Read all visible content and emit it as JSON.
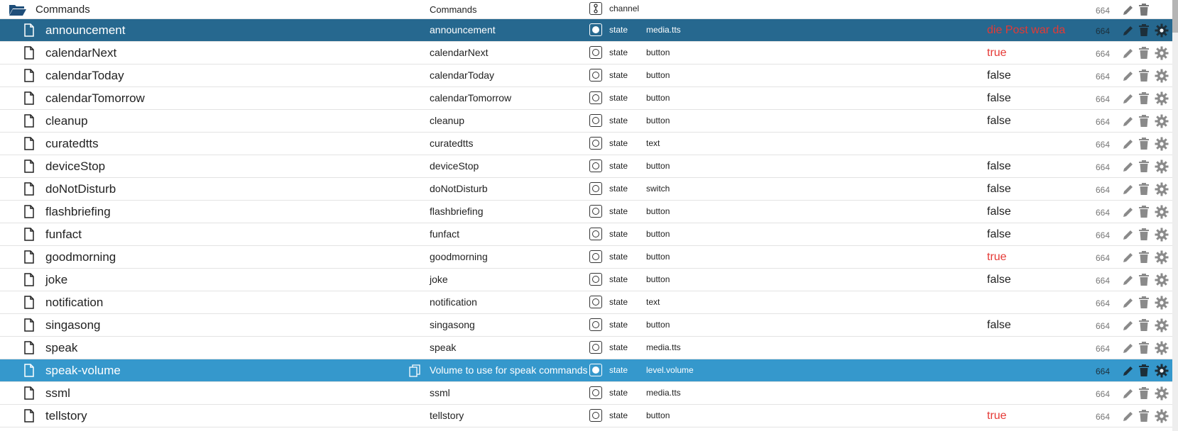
{
  "colors": {
    "selected_dark": "#26688f",
    "selected_light": "#3598cc",
    "value_true": "#e53935",
    "value_false": "#222222"
  },
  "folder": {
    "id": "Commands",
    "name": "Commands",
    "type": "channel",
    "acl": "664",
    "icon": "folder-open-icon"
  },
  "rows": [
    {
      "id": "announcement",
      "name": "announcement",
      "type": "state",
      "role": "media.tts",
      "value": "die Post war da",
      "value_color": "red",
      "acl": "664",
      "selected": "dark"
    },
    {
      "id": "calendarNext",
      "name": "calendarNext",
      "type": "state",
      "role": "button",
      "value": "true",
      "value_color": "red",
      "acl": "664"
    },
    {
      "id": "calendarToday",
      "name": "calendarToday",
      "type": "state",
      "role": "button",
      "value": "false",
      "value_color": "dark",
      "acl": "664"
    },
    {
      "id": "calendarTomorrow",
      "name": "calendarTomorrow",
      "type": "state",
      "role": "button",
      "value": "false",
      "value_color": "dark",
      "acl": "664"
    },
    {
      "id": "cleanup",
      "name": "cleanup",
      "type": "state",
      "role": "button",
      "value": "false",
      "value_color": "dark",
      "acl": "664"
    },
    {
      "id": "curatedtts",
      "name": "curatedtts",
      "type": "state",
      "role": "text",
      "value": "",
      "value_color": "dark",
      "acl": "664"
    },
    {
      "id": "deviceStop",
      "name": "deviceStop",
      "type": "state",
      "role": "button",
      "value": "false",
      "value_color": "dark",
      "acl": "664"
    },
    {
      "id": "doNotDisturb",
      "name": "doNotDisturb",
      "type": "state",
      "role": "switch",
      "value": "false",
      "value_color": "dark",
      "acl": "664"
    },
    {
      "id": "flashbriefing",
      "name": "flashbriefing",
      "type": "state",
      "role": "button",
      "value": "false",
      "value_color": "dark",
      "acl": "664"
    },
    {
      "id": "funfact",
      "name": "funfact",
      "type": "state",
      "role": "button",
      "value": "false",
      "value_color": "dark",
      "acl": "664"
    },
    {
      "id": "goodmorning",
      "name": "goodmorning",
      "type": "state",
      "role": "button",
      "value": "true",
      "value_color": "red",
      "acl": "664"
    },
    {
      "id": "joke",
      "name": "joke",
      "type": "state",
      "role": "button",
      "value": "false",
      "value_color": "dark",
      "acl": "664"
    },
    {
      "id": "notification",
      "name": "notification",
      "type": "state",
      "role": "text",
      "value": "",
      "value_color": "dark",
      "acl": "664"
    },
    {
      "id": "singasong",
      "name": "singasong",
      "type": "state",
      "role": "button",
      "value": "false",
      "value_color": "dark",
      "acl": "664"
    },
    {
      "id": "speak",
      "name": "speak",
      "type": "state",
      "role": "media.tts",
      "value": "",
      "value_color": "dark",
      "acl": "664"
    },
    {
      "id": "speak-volume",
      "name": "Volume to use for speak commands",
      "type": "state",
      "role": "level.volume",
      "value": "",
      "value_color": "dark",
      "acl": "664",
      "selected": "light",
      "copy_icon": true
    },
    {
      "id": "ssml",
      "name": "ssml",
      "type": "state",
      "role": "media.tts",
      "value": "",
      "value_color": "dark",
      "acl": "664"
    },
    {
      "id": "tellstory",
      "name": "tellstory",
      "type": "state",
      "role": "button",
      "value": "true",
      "value_color": "red",
      "acl": "664"
    }
  ]
}
